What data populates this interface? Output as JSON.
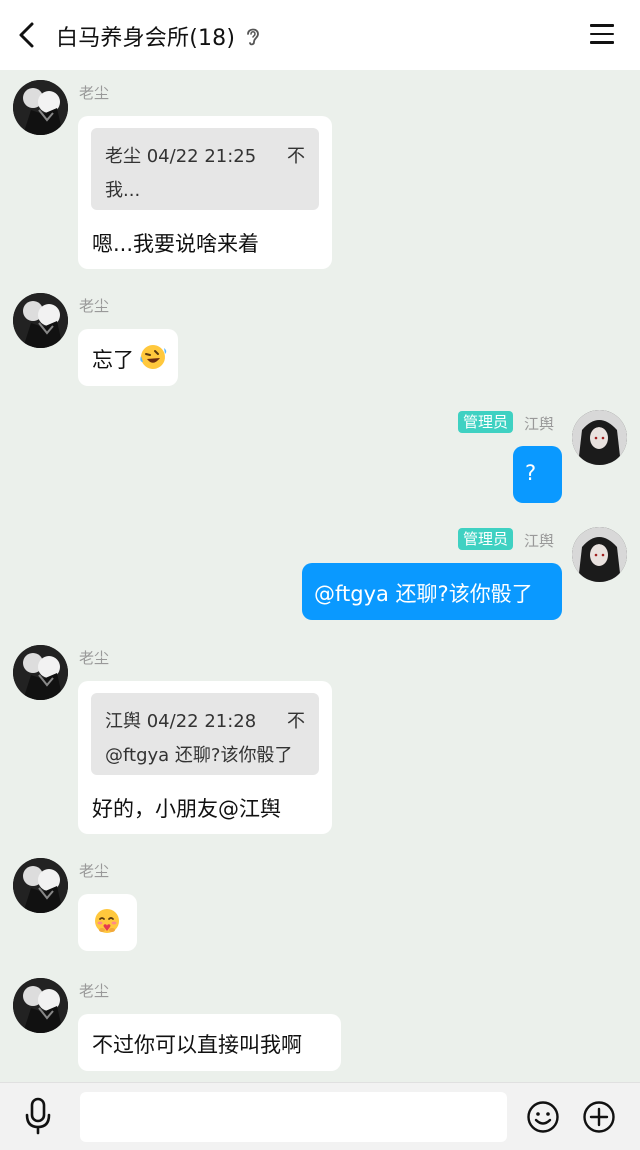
{
  "header": {
    "title": "白马养身会所(18)",
    "back_icon": "chevron-left-icon",
    "ear_icon": "ear-icon",
    "menu_icon": "hamburger-menu-icon"
  },
  "messages": [
    {
      "sender": "老尘",
      "side": "left",
      "quote": {
        "head": "老尘 04/22 21:25",
        "body": "我...",
        "pin": "不"
      },
      "text": "嗯...我要说啥来着"
    },
    {
      "sender": "老尘",
      "side": "left",
      "text": "忘了",
      "emoji": "laughing-tears-emoji"
    },
    {
      "sender": "江舆",
      "badge": "管理员",
      "side": "right",
      "text": "?"
    },
    {
      "sender": "江舆",
      "badge": "管理员",
      "side": "right",
      "text": "@ftgya 还聊?该你骰了"
    },
    {
      "sender": "老尘",
      "side": "left",
      "quote": {
        "head": "江舆 04/22 21:28",
        "body": "@ftgya 还聊?该你骰了",
        "pin": "不"
      },
      "text": "好的，小朋友@江舆"
    },
    {
      "sender": "老尘",
      "side": "left",
      "emoji": "face-holding-heart-emoji"
    },
    {
      "sender": "老尘",
      "side": "left",
      "text": "不过你可以直接叫我啊"
    }
  ],
  "footer": {
    "input_value": "",
    "mic_icon": "microphone-icon",
    "emoji_icon": "smiley-face-icon",
    "plus_icon": "plus-circle-icon"
  },
  "colors": {
    "chat_bg": "#ebf0eb",
    "self_bubble": "#0a99ff",
    "admin_badge": "#3fd1c2"
  }
}
